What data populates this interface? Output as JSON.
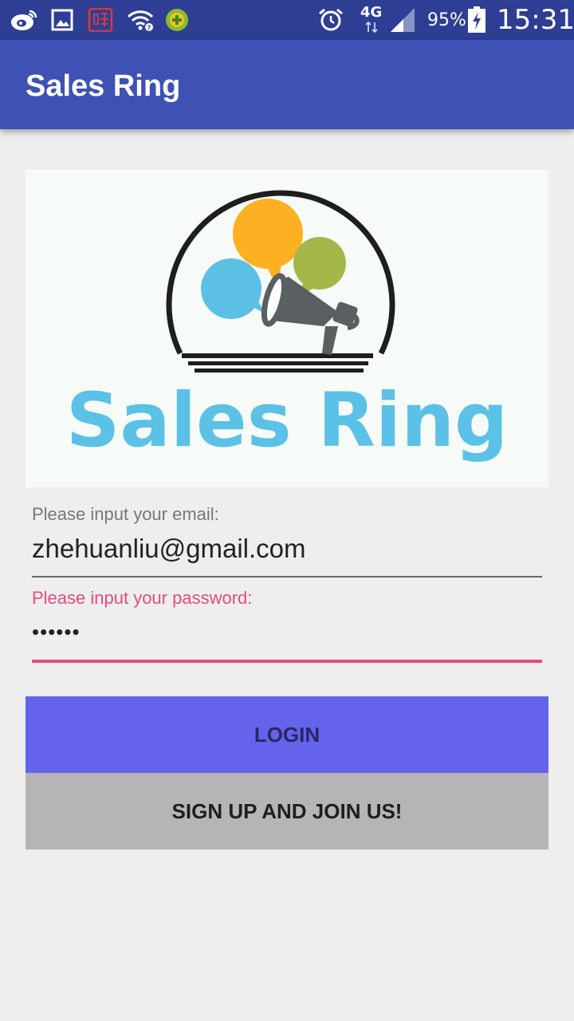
{
  "status_bar": {
    "icons": [
      "weibo-icon",
      "gallery-icon",
      "notification-app-icon",
      "wifi-icon",
      "security-app-icon",
      "alarm-icon",
      "network-4g-icon",
      "signal-icon",
      "battery-charging-icon"
    ],
    "network_label": "4G",
    "battery_percent": "95%",
    "time": "15:31"
  },
  "app_bar": {
    "title": "Sales Ring"
  },
  "logo": {
    "wordmark": "Sales Ring",
    "colors": {
      "ring": "#1e1e1e",
      "bubble_orange": "#fdb022",
      "bubble_green": "#a4b84a",
      "bubble_blue": "#5cc0e4",
      "megaphone": "#5a5f62",
      "wordmark": "#5bc1e6"
    }
  },
  "form": {
    "email_label": "Please input your email:",
    "email_value": "zhehuanliu@gmail.com",
    "password_label": "Please input your password:",
    "password_value": "••••••"
  },
  "buttons": {
    "login": "LOGIN",
    "signup": "SIGN UP AND JOIN US!"
  },
  "colors": {
    "status_bar": "#2e3e94",
    "app_bar": "#3f51b5",
    "accent": "#e84a82",
    "login_button": "#6563ec",
    "signup_button": "#b5b5b5",
    "background": "#eeeeee"
  }
}
